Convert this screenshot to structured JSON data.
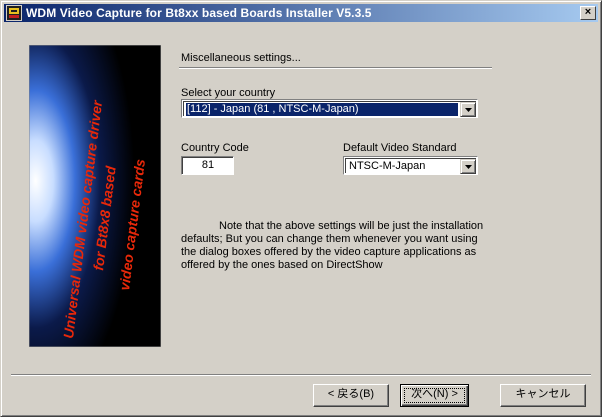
{
  "window": {
    "title": "WDM Video Capture for Bt8xx based Boards Installer V5.3.5",
    "close_label": "×"
  },
  "banner": {
    "line1": "Universal WDM video capture driver",
    "line2": "for Bt8x8 based",
    "line3": "video capture cards"
  },
  "section": {
    "title": "Miscellaneous settings..."
  },
  "country": {
    "label": "Select your country",
    "value": "[112] - Japan (81 , NTSC-M-Japan)"
  },
  "country_code": {
    "label": "Country Code",
    "value": "81"
  },
  "video_standard": {
    "label": "Default Video Standard",
    "value": "NTSC-M-Japan"
  },
  "note": {
    "text": "Note that the above settings will be just the installation defaults; But you can change them whenever you want using the dialog boxes offered by the video capture applications as offered by the ones based on DirectShow"
  },
  "buttons": {
    "back": "< 戻る(B)",
    "next": "次へ(N) >",
    "cancel": "キャンセル"
  },
  "colors": {
    "titlebar_start": "#0a246a",
    "titlebar_end": "#a6caf0",
    "selection": "#0a246a",
    "face": "#d4d0c8",
    "banner_text": "#e8280a"
  }
}
